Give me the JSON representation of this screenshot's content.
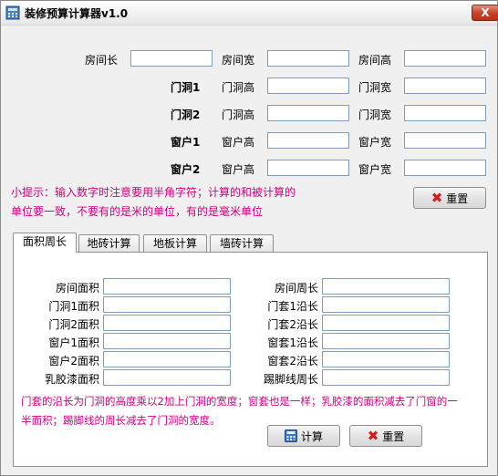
{
  "window": {
    "title": "装修预算计算器v1.0",
    "close_label": "X"
  },
  "room": {
    "length_label": "房间长",
    "width_label": "房间宽",
    "height_label": "房间高"
  },
  "openings": [
    {
      "name": "门洞1",
      "a_label": "门洞高",
      "b_label": "门洞宽"
    },
    {
      "name": "门洞2",
      "a_label": "门洞高",
      "b_label": "门洞宽"
    },
    {
      "name": "窗户1",
      "a_label": "窗户高",
      "b_label": "窗户宽"
    },
    {
      "name": "窗户2",
      "a_label": "窗户高",
      "b_label": "窗户宽"
    }
  ],
  "tip": {
    "line1": "小提示：输入数字时注意要用半角字符；计算的和被计算的",
    "line2": "单位要一致，不要有的是米的单位，有的是毫米单位"
  },
  "reset_label": "重置",
  "tabs": [
    "面积周长",
    "地砖计算",
    "地板计算",
    "墙砖计算"
  ],
  "area_panel": {
    "left": [
      "房间面积",
      "门洞1面积",
      "门洞2面积",
      "窗户1面积",
      "窗户2面积",
      "乳胶漆面积"
    ],
    "right": [
      "房间周长",
      "门套1沿长",
      "门套2沿长",
      "窗套1沿长",
      "窗套2沿长",
      "踢脚线周长"
    ],
    "note_line1": "门套的沿长为门洞的高度乘以2加上门洞的宽度；窗套也是一样；乳胶漆的面积减去了门窗的一",
    "note_line2": "半面积；踢脚线的周长减去了门洞的宽度。",
    "calc_label": "计算",
    "reset_label": "重置"
  },
  "colors": {
    "hint": "#d00080",
    "reset_icon": "#d21b1b"
  }
}
